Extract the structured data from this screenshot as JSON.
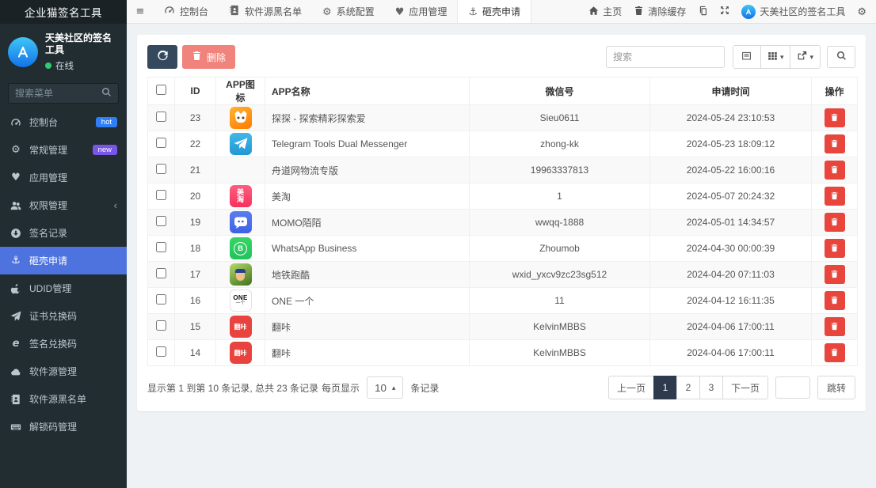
{
  "brand": {
    "title": "企业猫签名工具"
  },
  "colors": {
    "sidebar_bg": "#222d32",
    "sidebar_active": "#4e73df",
    "online_green": "#2ecc71",
    "badge_hot": "#2e7ff7",
    "badge_new": "#7a56e8",
    "refresh_btn": "#34495e",
    "delete_btn": "#f0837b",
    "row_delete": "#e8453c",
    "page_active": "#2e3a4d"
  },
  "sidebar": {
    "user": {
      "name": "天美社区的签名工具",
      "status_label": "在线"
    },
    "search_placeholder": "搜索菜单",
    "items": [
      {
        "label": "控制台",
        "icon": "gauge-icon",
        "badge": {
          "text": "hot",
          "color": "#2e7ff7"
        }
      },
      {
        "label": "常规管理",
        "icon": "cogs-icon",
        "badge": {
          "text": "new",
          "color": "#7a56e8"
        }
      },
      {
        "label": "应用管理",
        "icon": "heart-icon"
      },
      {
        "label": "权限管理",
        "icon": "users-icon",
        "chevron": "‹"
      },
      {
        "label": "签名记录",
        "icon": "arrow-down-circle-icon"
      },
      {
        "label": "砸壳申请",
        "icon": "anchor-icon",
        "active": true
      },
      {
        "label": "UDID管理",
        "icon": "apple-icon"
      },
      {
        "label": "证书兑换码",
        "icon": "paper-plane-icon"
      },
      {
        "label": "签名兑换码",
        "icon": "edge-icon"
      },
      {
        "label": "软件源管理",
        "icon": "cloud-icon"
      },
      {
        "label": "软件源黑名单",
        "icon": "address-book-icon"
      },
      {
        "label": "解锁码管理",
        "icon": "keyboard-icon"
      }
    ]
  },
  "navbar": {
    "tabs": [
      {
        "label": "控制台",
        "icon": "gauge-icon"
      },
      {
        "label": "软件源黑名单",
        "icon": "address-book-icon"
      },
      {
        "label": "系统配置",
        "icon": "gear-icon"
      },
      {
        "label": "应用管理",
        "icon": "heart-icon"
      },
      {
        "label": "砸壳申请",
        "icon": "anchor-icon",
        "active": true
      }
    ],
    "right": {
      "home_label": "主页",
      "clear_cache_label": "清除缓存",
      "user_label": "天美社区的签名工具"
    }
  },
  "panel": {
    "toolbar": {
      "delete_label": "删除",
      "search_placeholder": "搜索"
    },
    "table": {
      "columns": [
        "ID",
        "APP图标",
        "APP名称",
        "微信号",
        "申请时间",
        "操作"
      ],
      "rows": [
        {
          "id": "23",
          "app_name": "探探 - 探索精彩探索爱",
          "wechat": "Sieu0611",
          "applied_at": "2024-05-24 23:10:53",
          "icon": {
            "kind": "tantan",
            "bg": "#ff8a00",
            "label": ""
          }
        },
        {
          "id": "22",
          "app_name": "Telegram Tools Dual Messenger",
          "wechat": "zhong-kk",
          "applied_at": "2024-05-23 18:09:12",
          "icon": {
            "kind": "telegram",
            "bg": "#37aee2",
            "label": ""
          }
        },
        {
          "id": "21",
          "app_name": "舟道网物流专版",
          "wechat": "19963337813",
          "applied_at": "2024-05-22 16:00:16",
          "icon": null
        },
        {
          "id": "20",
          "app_name": "美淘",
          "wechat": "1",
          "applied_at": "2024-05-07 20:24:32",
          "icon": {
            "kind": "meitao",
            "bg": "#f5315d",
            "label": "美淘"
          }
        },
        {
          "id": "19",
          "app_name": "MOMO陌陌",
          "wechat": "wwqq-1888",
          "applied_at": "2024-05-01 14:34:57",
          "icon": {
            "kind": "momo",
            "bg": "#3f62e4",
            "label": ""
          }
        },
        {
          "id": "18",
          "app_name": "WhatsApp Business",
          "wechat": "Zhoumob",
          "applied_at": "2024-04-30 00:00:39",
          "icon": {
            "kind": "whatsapp",
            "bg": "#23c25e",
            "label": "B"
          }
        },
        {
          "id": "17",
          "app_name": "地铁跑酷",
          "wechat": "wxid_yxcv9zc23sg512",
          "applied_at": "2024-04-20 07:11:03",
          "icon": {
            "kind": "subway",
            "bg": "#6aa83e",
            "label": ""
          }
        },
        {
          "id": "16",
          "app_name": "ONE 一个",
          "wechat": "11",
          "applied_at": "2024-04-12 16:11:35",
          "icon": {
            "kind": "one",
            "bg": "#ffffff",
            "label": "ONE"
          }
        },
        {
          "id": "15",
          "app_name": "翻咔",
          "wechat": "KelvinMBBS",
          "applied_at": "2024-04-06 17:00:11",
          "icon": {
            "kind": "fanka",
            "bg": "#e8433f",
            "label": "翻咔"
          }
        },
        {
          "id": "14",
          "app_name": "翻咔",
          "wechat": "KelvinMBBS",
          "applied_at": "2024-04-06 17:00:11",
          "icon": {
            "kind": "fanka",
            "bg": "#e8433f",
            "label": "翻咔"
          }
        }
      ]
    },
    "pagination": {
      "summary": "显示第 1 到第 10 条记录, 总共 23 条记录",
      "page_size_prefix": "每页显示",
      "page_size": "10",
      "page_size_suffix": "条记录",
      "prev_label": "上一页",
      "pages": [
        "1",
        "2",
        "3"
      ],
      "active_page": "1",
      "next_label": "下一页",
      "jump_label": "跳转"
    }
  }
}
